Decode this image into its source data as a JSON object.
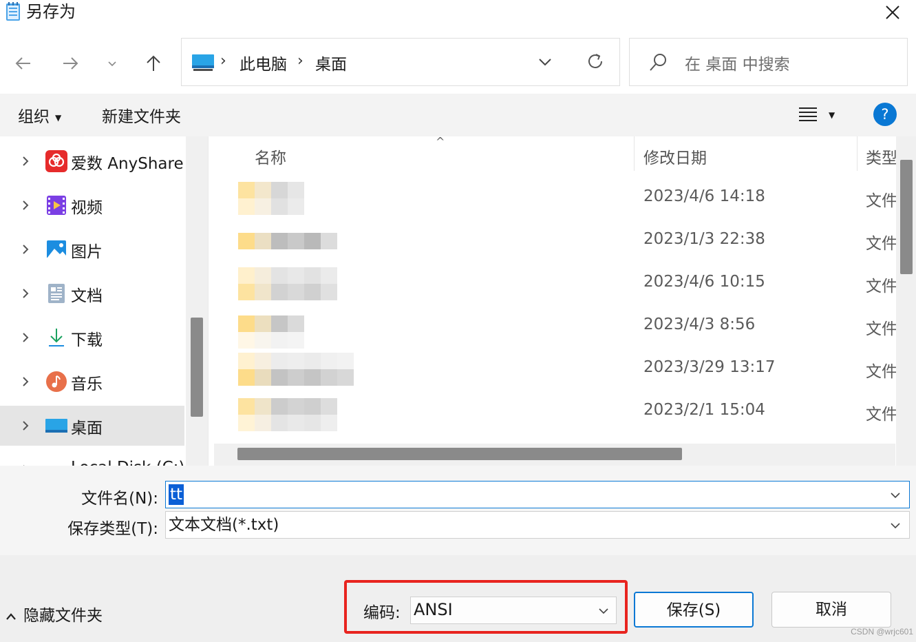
{
  "window": {
    "title": "另存为",
    "close_glyph": "✕"
  },
  "nav": {
    "back_icon": "arrow-left-icon",
    "forward_icon": "arrow-right-icon",
    "recent_icon": "chevron-down-icon",
    "up_icon": "arrow-up-icon"
  },
  "address": {
    "crumbs": [
      "此电脑",
      "桌面"
    ],
    "separator": "›"
  },
  "search": {
    "placeholder": "在 桌面 中搜索"
  },
  "toolbar": {
    "organize_label": "组织",
    "new_folder_label": "新建文件夹",
    "help_label": "?"
  },
  "sidebar": {
    "items": [
      {
        "label": "爱数 AnyShare",
        "icon": "anyshare-icon"
      },
      {
        "label": "视频",
        "icon": "video-icon"
      },
      {
        "label": "图片",
        "icon": "pictures-icon"
      },
      {
        "label": "文档",
        "icon": "documents-icon"
      },
      {
        "label": "下载",
        "icon": "download-icon"
      },
      {
        "label": "音乐",
        "icon": "music-icon"
      },
      {
        "label": "桌面",
        "icon": "desktop-icon",
        "selected": true
      },
      {
        "label": "Local Disk (C:)",
        "icon": "drive-icon"
      }
    ]
  },
  "filelist": {
    "columns": [
      "名称",
      "修改日期",
      "类型"
    ],
    "rows": [
      {
        "date": "2023/4/6 14:18",
        "type": "文件"
      },
      {
        "date": "2023/1/3 22:38",
        "type": "文件"
      },
      {
        "date": "2023/4/6 10:15",
        "type": "文件"
      },
      {
        "date": "2023/4/3 8:56",
        "type": "文件"
      },
      {
        "date": "2023/3/29 13:17",
        "type": "文件"
      },
      {
        "date": "2023/2/1 15:04",
        "type": "文件"
      }
    ]
  },
  "form": {
    "filename_label": "文件名(N):",
    "filename_value": "tt",
    "filetype_label": "保存类型(T):",
    "filetype_value": "文本文档(*.txt)"
  },
  "footer": {
    "hide_folders_label": "隐藏文件夹",
    "encoding_label": "编码:",
    "encoding_value": "ANSI",
    "save_label": "保存(S)",
    "cancel_label": "取消",
    "watermark": "CSDN @wrjc601",
    "highlight_color": "#e8241f",
    "accent_color": "#0a78d4"
  }
}
